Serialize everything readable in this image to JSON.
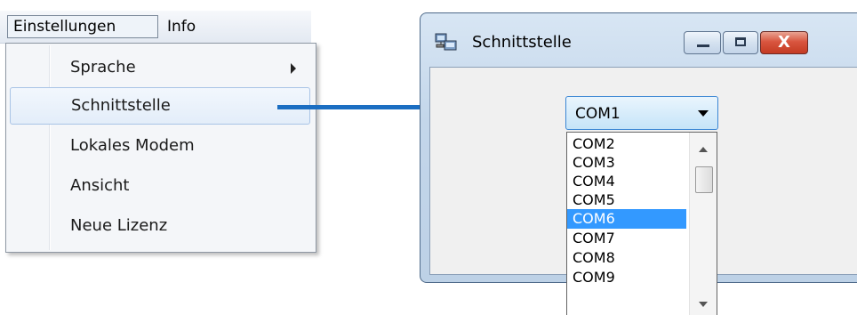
{
  "menubar": {
    "items": [
      {
        "label": "Einstellungen"
      },
      {
        "label": "Info"
      }
    ]
  },
  "menu": {
    "items": [
      {
        "label": "Sprache",
        "has_submenu": true
      },
      {
        "label": "Schnittstelle",
        "hovered": true
      },
      {
        "label": "Lokales Modem"
      },
      {
        "label": "Ansicht"
      },
      {
        "label": "Neue Lizenz"
      }
    ]
  },
  "window": {
    "title": "Schnittstelle",
    "icon": "network-computer-icon",
    "buttons": [
      "minimize",
      "maximize",
      "close"
    ],
    "close_glyph": "X"
  },
  "combo": {
    "value": "COM1",
    "options": [
      "COM2",
      "COM3",
      "COM4",
      "COM5",
      "COM6",
      "COM7",
      "COM8",
      "COM9"
    ],
    "highlighted": "COM6"
  },
  "colors": {
    "arrow": "#1b6ec2",
    "selection": "#3399ff",
    "close_button": "#c43b22"
  }
}
